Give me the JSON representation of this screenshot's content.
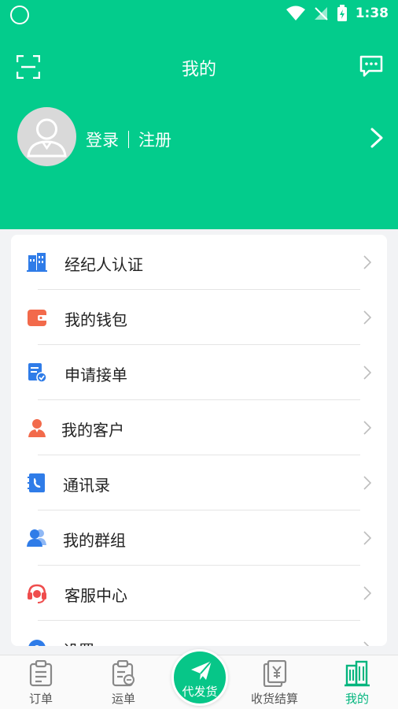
{
  "status_bar": {
    "time": "1:38"
  },
  "header": {
    "title": "我的",
    "login_label": "登录",
    "register_label": "注册"
  },
  "menu": [
    {
      "label": "经纪人认证",
      "icon": "building-badge-icon",
      "color": "#2f7ce8"
    },
    {
      "label": "我的钱包",
      "icon": "wallet-icon",
      "color": "#f26a4b"
    },
    {
      "label": "申请接单",
      "icon": "document-check-icon",
      "color": "#2f7ce8"
    },
    {
      "label": "我的客户",
      "icon": "customer-icon",
      "color": "#f26a4b"
    },
    {
      "label": "通讯录",
      "icon": "address-book-icon",
      "color": "#2f7ce8"
    },
    {
      "label": "我的群组",
      "icon": "group-icon",
      "color": "#2f7ce8"
    },
    {
      "label": "客服中心",
      "icon": "headset-icon",
      "color": "#ef4d4d"
    },
    {
      "label": "设置",
      "icon": "settings-icon",
      "color": "#2f7ce8"
    }
  ],
  "tabs": {
    "orders": "订单",
    "waybill": "运单",
    "ship_on_behalf": "代发货",
    "settlement": "收货结算",
    "mine": "我的"
  },
  "colors": {
    "brand": "#03cc8c",
    "active_tab": "#03b57e"
  }
}
